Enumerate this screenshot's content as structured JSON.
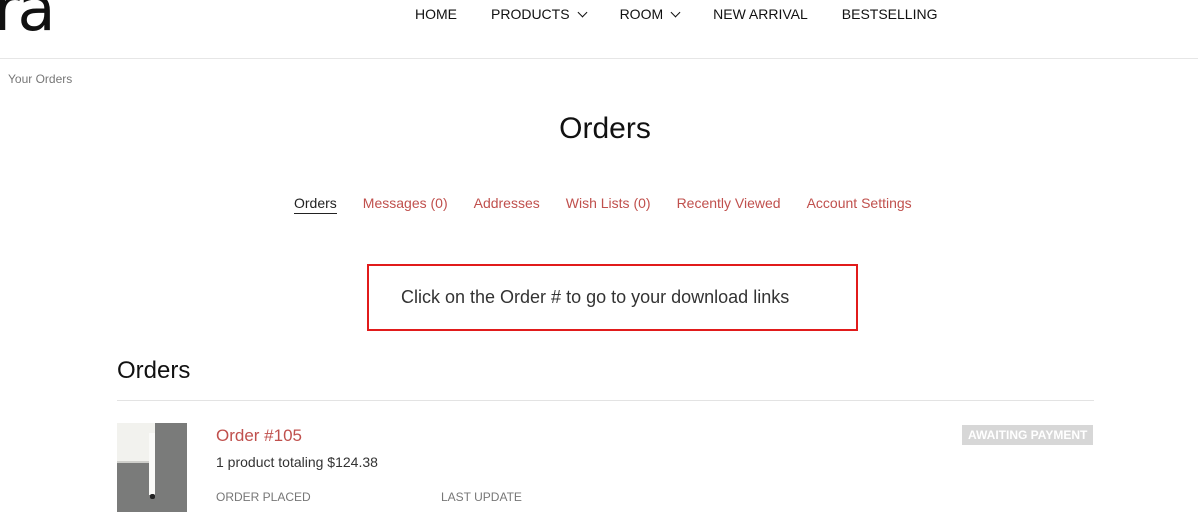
{
  "header": {
    "logo": "ra",
    "nav": [
      {
        "label": "HOME"
      },
      {
        "label": "PRODUCTS"
      },
      {
        "label": "ROOM"
      },
      {
        "label": "NEW ARRIVAL"
      },
      {
        "label": "BESTSELLING"
      }
    ]
  },
  "breadcrumb": {
    "current": "Your Orders"
  },
  "page": {
    "title": "Orders"
  },
  "tabs": [
    {
      "label": "Orders"
    },
    {
      "label": "Messages (0)"
    },
    {
      "label": "Addresses"
    },
    {
      "label": "Wish Lists (0)"
    },
    {
      "label": "Recently Viewed"
    },
    {
      "label": "Account Settings"
    }
  ],
  "notice": {
    "text": "Click on the Order # to go to your download links",
    "border_color": "#e11b1b"
  },
  "orders": {
    "heading": "Orders",
    "items": [
      {
        "order_number": "Order #105",
        "summary": "1 product totaling $124.38",
        "status": "AWAITING PAYMENT",
        "placed_label": "ORDER PLACED",
        "updated_label": "LAST UPDATE"
      }
    ]
  },
  "colors": {
    "accent": "#c0504d",
    "badge_bg": "#d7d7d7"
  }
}
